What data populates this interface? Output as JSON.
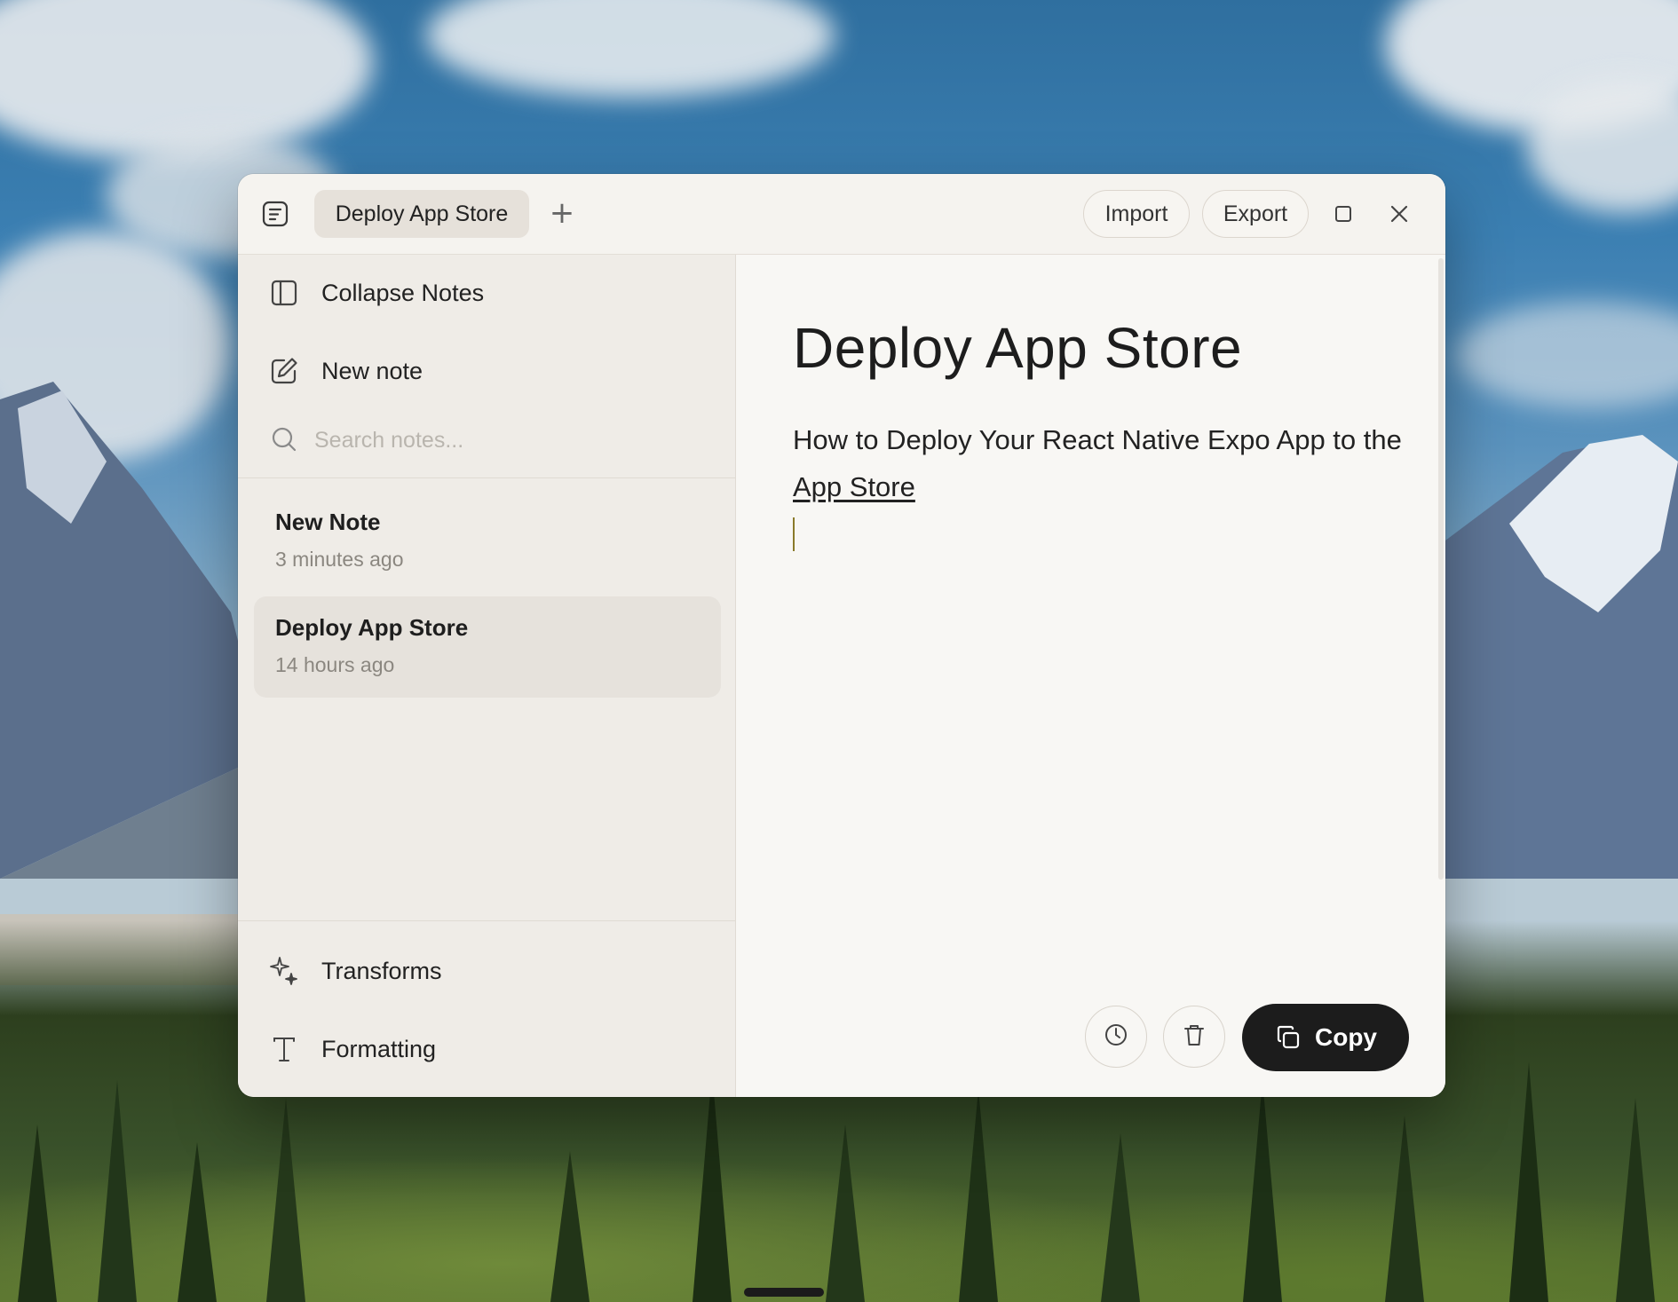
{
  "titlebar": {
    "tab_label": "Deploy App Store",
    "add_tab_icon": "plus-icon",
    "import_label": "Import",
    "export_label": "Export"
  },
  "sidebar": {
    "collapse_label": "Collapse Notes",
    "new_note_label": "New note",
    "search_placeholder": "Search notes...",
    "notes": [
      {
        "title": "New Note",
        "time": "3 minutes ago",
        "active": false
      },
      {
        "title": "Deploy App Store",
        "time": "14 hours ago",
        "active": true
      }
    ],
    "transforms_label": "Transforms",
    "formatting_label": "Formatting"
  },
  "editor": {
    "title": "Deploy App Store",
    "body_text": "How to Deploy Your React Native Expo App to the ",
    "link_text": "App Store",
    "copy_label": "Copy"
  },
  "colors": {
    "window_bg": "#f5f3ef",
    "sidebar_bg": "#efece7",
    "active_note_bg": "#e6e2dc",
    "copy_button_bg": "#1c1c1c"
  }
}
